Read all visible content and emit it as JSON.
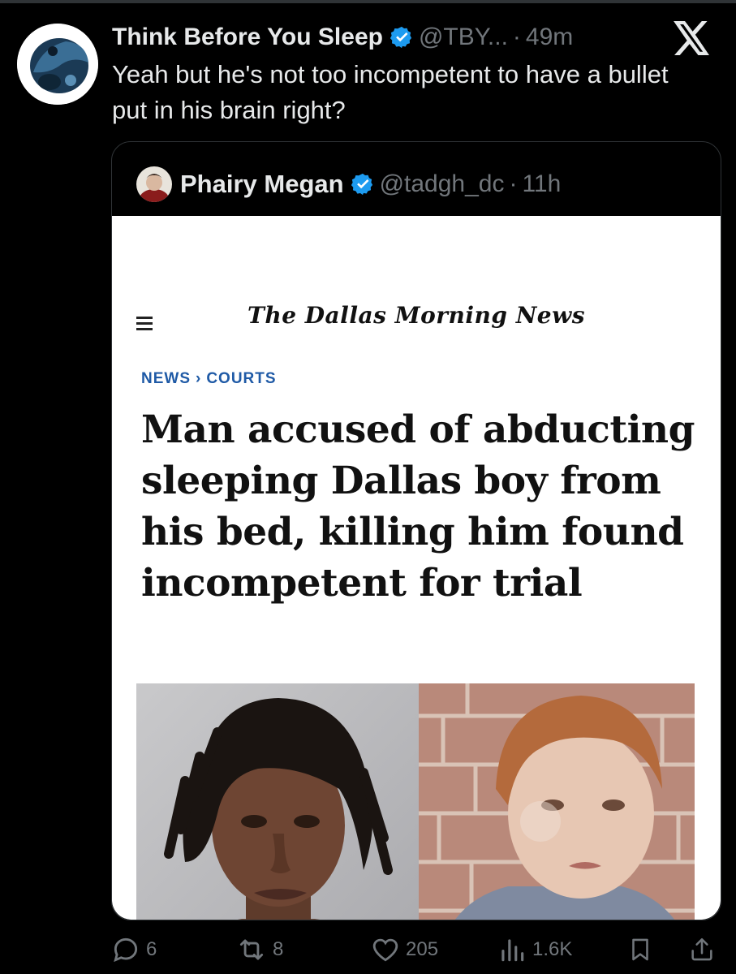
{
  "tweet": {
    "author_name": "Think Before You Sleep",
    "handle": "@TBY...",
    "separator": "·",
    "time": "49m",
    "text": "Yeah but he's not too incompetent to have a bullet put in his brain right?",
    "avatar_icon": "yin-yang-stone-icon"
  },
  "quoted": {
    "author_name": "Phairy Megan",
    "handle": "@tadgh_dc",
    "separator": "·",
    "time": "11h",
    "article": {
      "masthead": "The Dallas Morning News",
      "crumb_1": "NEWS",
      "crumb_sep": "›",
      "crumb_2": "COURTS",
      "headline": "Man accused of abducting sleeping Dallas boy from his bed, killing him found incompetent for trial"
    }
  },
  "actions": {
    "replies": "6",
    "retweets": "8",
    "likes": "205",
    "views": "1.6K"
  },
  "colors": {
    "background": "#000000",
    "text": "#e7e9ea",
    "muted": "#71767b",
    "verified": "#1d9bf0",
    "crumb_blue": "#1f5aa6"
  }
}
